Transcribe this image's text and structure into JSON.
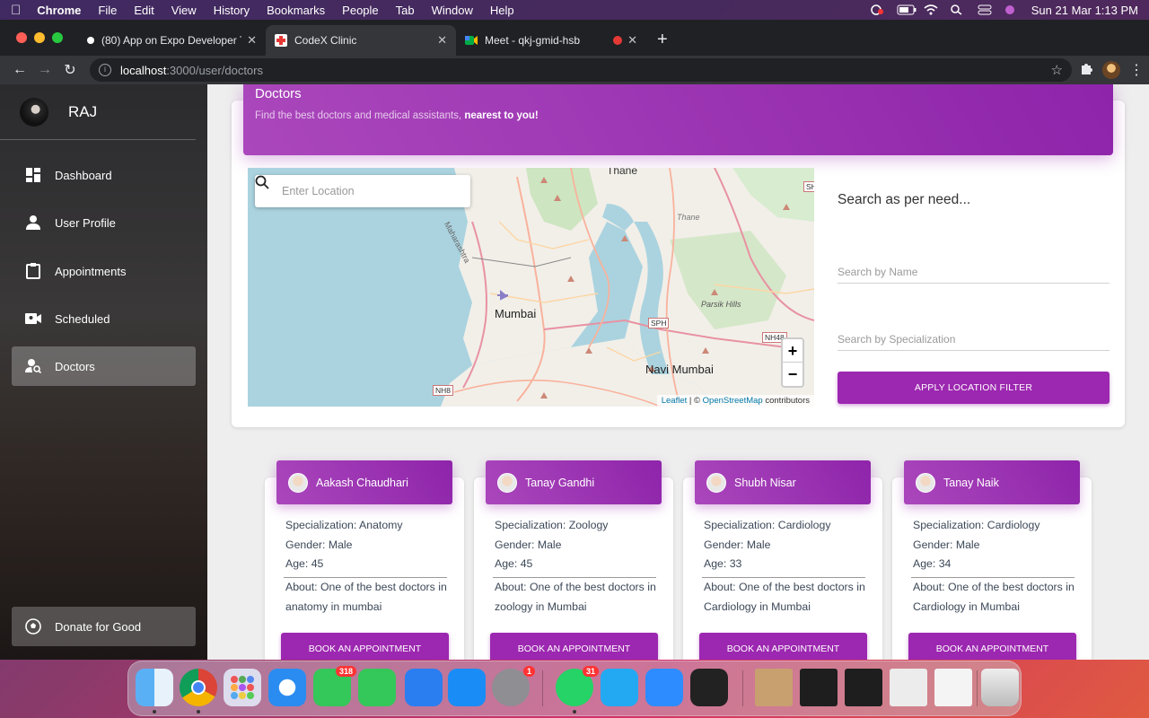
{
  "menubar": {
    "app": "Chrome",
    "menus": [
      "File",
      "Edit",
      "View",
      "History",
      "Bookmarks",
      "People",
      "Tab",
      "Window",
      "Help"
    ],
    "clock": "Sun 21 Mar  1:13 PM"
  },
  "browser": {
    "tabs": [
      {
        "title": "(80) App on Expo Developer To",
        "active": false
      },
      {
        "title": "CodeX Clinic",
        "active": true
      },
      {
        "title": "Meet - qkj-gmid-hsb",
        "active": false
      }
    ],
    "url_host": "localhost",
    "url_path": ":3000/user/doctors"
  },
  "sidebar": {
    "user_name": "RAJ",
    "items": [
      {
        "label": "Dashboard",
        "icon": "dashboard-icon"
      },
      {
        "label": "User Profile",
        "icon": "person-icon"
      },
      {
        "label": "Appointments",
        "icon": "clipboard-icon"
      },
      {
        "label": "Scheduled",
        "icon": "video-icon"
      },
      {
        "label": "Doctors",
        "icon": "person-search-icon",
        "active": true
      }
    ],
    "donate_label": "Donate for Good"
  },
  "header": {
    "title": "Doctors",
    "subtitle_pre": "Find the best doctors and medical assistants, ",
    "subtitle_bold": "nearest to you!"
  },
  "map": {
    "search_placeholder": "Enter Location",
    "labels": {
      "city": "Mumbai",
      "navi": "Navi Mumbai",
      "thane": "Thane",
      "parsik": "Parsik Hills",
      "maharashtra": "Maharashtra",
      "top": "Thane"
    },
    "shields": [
      "SH",
      "SPH",
      "NH48",
      "NH8"
    ],
    "zoom_in": "+",
    "zoom_out": "−",
    "attribution_leaflet": "Leaflet",
    "attribution_sep": " | © ",
    "attribution_osm": "OpenStreetMap",
    "attribution_tail": " contributors"
  },
  "filter": {
    "title": "Search as per need...",
    "name_placeholder": "Search by Name",
    "spec_placeholder": "Search by Specialization",
    "apply_label": "APPLY LOCATION FILTER"
  },
  "doctors": [
    {
      "name": "Aakash Chaudhari",
      "specialization": "Specialization: Anatomy",
      "gender": "Gender: Male",
      "age": "Age: 45",
      "about": "About: One of the best doctors in anatomy in mumbai"
    },
    {
      "name": "Tanay Gandhi",
      "specialization": "Specialization: Zoology",
      "gender": "Gender: Male",
      "age": "Age: 45",
      "about": "About: One of the best doctors in zoology in Mumbai"
    },
    {
      "name": "Shubh Nisar",
      "specialization": "Specialization: Cardiology",
      "gender": "Gender: Male",
      "age": "Age: 33",
      "about": "About: One of the best doctors in Cardiology in Mumbai"
    },
    {
      "name": "Tanay Naik",
      "specialization": "Specialization: Cardiology",
      "gender": "Gender: Male",
      "age": "Age: 34",
      "about": "About: One of the best doctors in Cardiology in Mumbai"
    }
  ],
  "book_label": "BOOK AN APPOINTMENT",
  "dock": {
    "badges": {
      "messages": "318",
      "settings": "1",
      "whatsapp": "31"
    }
  },
  "colors": {
    "accent": "#9c27b0",
    "accent_light": "#ab47bc"
  }
}
